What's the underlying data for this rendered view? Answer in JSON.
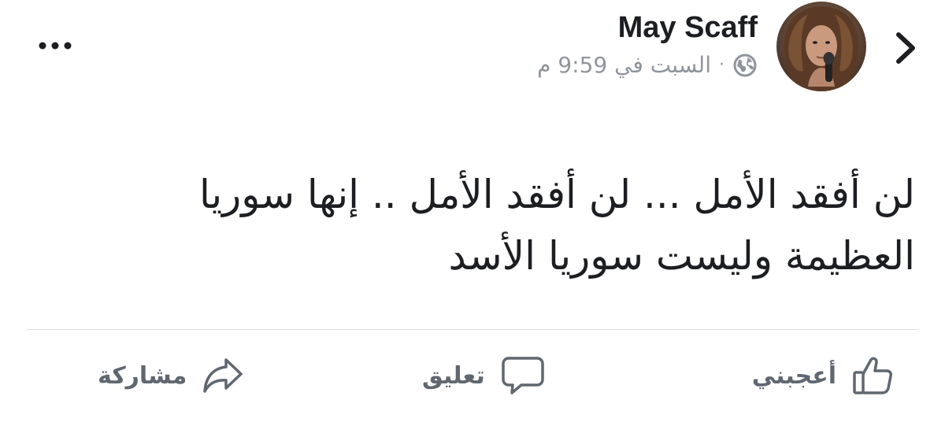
{
  "header": {
    "author_name": "May Scaff",
    "timestamp": "السبت في 9:59 م",
    "separator": "·",
    "privacy_icon": "globe-icon",
    "avatar_icon": "avatar-photo",
    "back_icon": "chevron-right-icon",
    "more_icon": "ellipsis-icon"
  },
  "post": {
    "text": "لن أفقد الأمل ... لن أفقد الأمل .. إنها سوريا\nالعظيمة وليست سوريا الأسد"
  },
  "actions": {
    "like_label": "أعجبني",
    "comment_label": "تعليق",
    "share_label": "مشاركة",
    "like_icon": "thumbs-up-icon",
    "comment_icon": "comment-bubble-icon",
    "share_icon": "share-arrow-icon"
  },
  "colors": {
    "text_primary": "#1c1e21",
    "text_secondary": "#90949c",
    "action_text": "#606770",
    "divider": "#dadde1"
  }
}
